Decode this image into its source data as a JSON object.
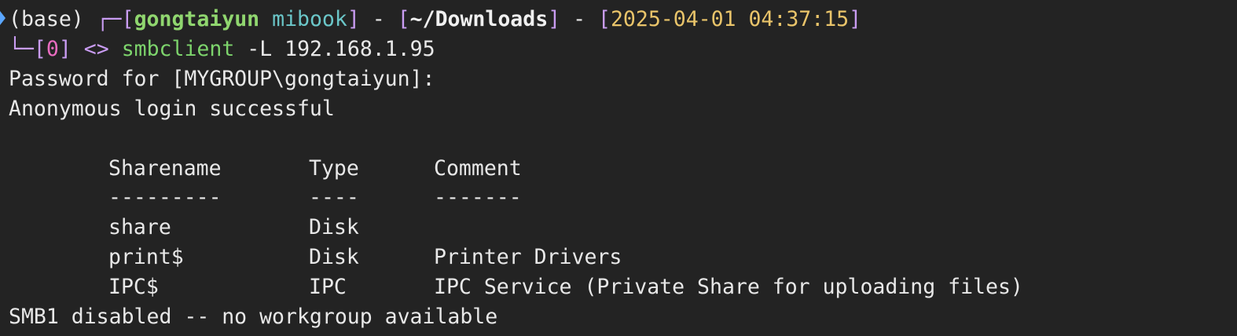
{
  "prompt": {
    "env": "(base)",
    "corner": "┌─",
    "open_bracket": "[",
    "user": "gongtaiyun",
    "host": "mibook",
    "close_bracket": "]",
    "sep": " - ",
    "dir": "~/Downloads",
    "datetime": "2025-04-01 04:37:15",
    "elbow": "└─",
    "status_code": "0",
    "arrow": "<>",
    "command_name": "smbclient",
    "command_args": "-L 192.168.1.95"
  },
  "output": {
    "password_prompt": "Password for [MYGROUP\\gongtaiyun]:",
    "login_message": "Anonymous login successful",
    "table": {
      "headers": [
        "Sharename",
        "Type",
        "Comment"
      ],
      "separators": [
        "---------",
        "----",
        "-------"
      ],
      "rows": [
        [
          "share",
          "Disk",
          ""
        ],
        [
          "print$",
          "Disk",
          "Printer Drivers"
        ],
        [
          "IPC$",
          "IPC",
          "IPC Service (Private Share for uploading files)"
        ]
      ]
    },
    "footer": "SMB1 disabled -- no workgroup available"
  },
  "colors": {
    "background": "#232323",
    "text": "#e8e8e8",
    "bracket": "#c99cf2",
    "user": "#90d66f",
    "host": "#6bc7c9",
    "datetime": "#e9c46a",
    "status_code": "#e96cc0",
    "command": "#7dd46c"
  }
}
